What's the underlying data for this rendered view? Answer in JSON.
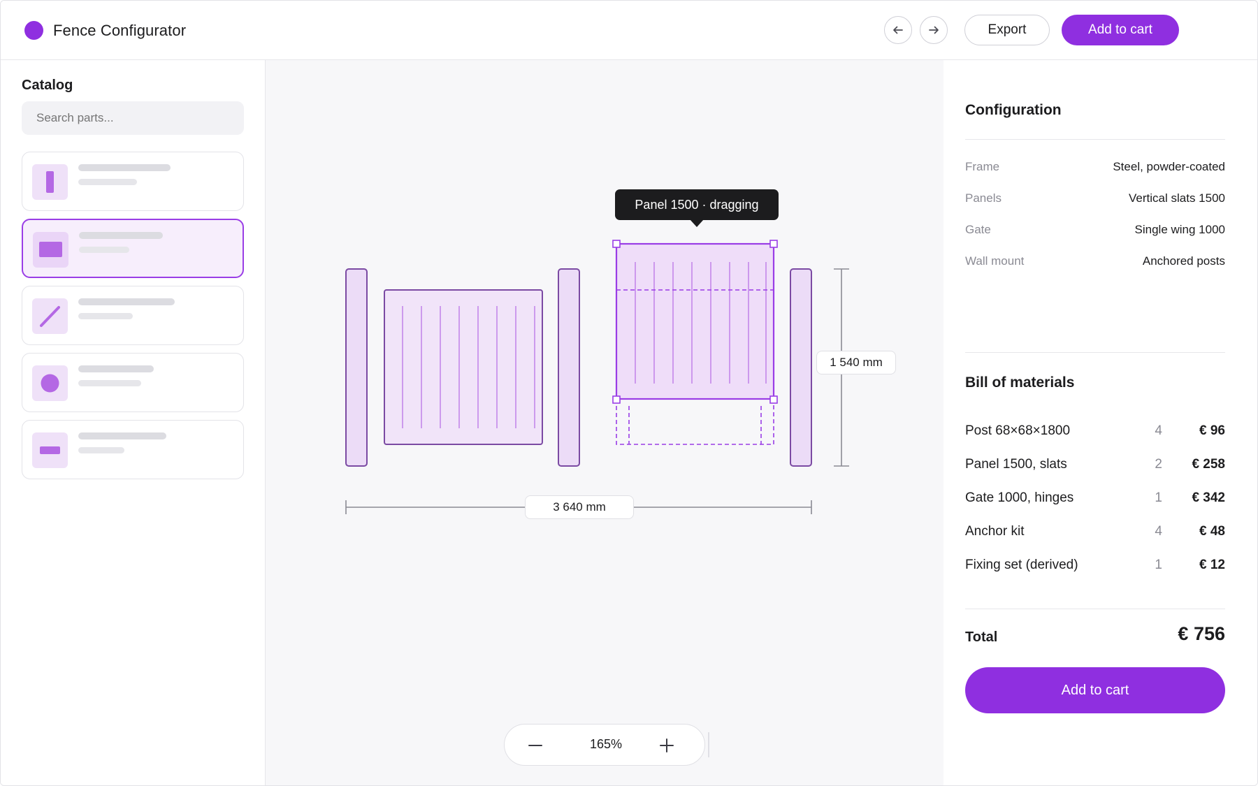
{
  "header": {
    "app_title": "Fence Configurator",
    "back_icon": "arrow-left-icon",
    "forward_icon": "arrow-right-icon",
    "export_label": "Export",
    "add_to_cart_label": "Add to cart",
    "accent_color": "#8f2fe0"
  },
  "sidebar": {
    "title": "Catalog",
    "search_placeholder": "Search parts...",
    "parts": [
      {
        "icon": "post-icon",
        "selected": false
      },
      {
        "icon": "panel-icon",
        "selected": true
      },
      {
        "icon": "diagonal-brace-icon",
        "selected": false
      },
      {
        "icon": "round-cap-icon",
        "selected": false
      },
      {
        "icon": "bracket-icon",
        "selected": false
      }
    ]
  },
  "canvas": {
    "tooltip": "Panel 1500 · dragging",
    "height_dimension": "1 540 mm",
    "width_dimension": "3 640 mm",
    "zoom_level": "165%",
    "zoom_out_icon": "minus-icon",
    "zoom_in_icon": "plus-icon"
  },
  "configuration": {
    "title": "Configuration",
    "rows": [
      {
        "key": "Frame",
        "value": "Steel, powder-coated"
      },
      {
        "key": "Panels",
        "value": "Vertical slats 1500"
      },
      {
        "key": "Gate",
        "value": "Single wing 1000"
      },
      {
        "key": "Wall mount",
        "value": "Anchored posts"
      }
    ]
  },
  "bill_of_materials": {
    "title": "Bill of materials",
    "items": [
      {
        "name": "Post 68×68×1800",
        "qty": "4",
        "price": "€ 96"
      },
      {
        "name": "Panel 1500, slats",
        "qty": "2",
        "price": "€ 258"
      },
      {
        "name": "Gate 1000, hinges",
        "qty": "1",
        "price": "€ 342"
      },
      {
        "name": "Anchor kit",
        "qty": "4",
        "price": "€ 48"
      },
      {
        "name": "Fixing set (derived)",
        "qty": "1",
        "price": "€ 12"
      }
    ],
    "total_label": "Total",
    "total_value": "€ 756",
    "add_to_cart_label": "Add to cart"
  }
}
